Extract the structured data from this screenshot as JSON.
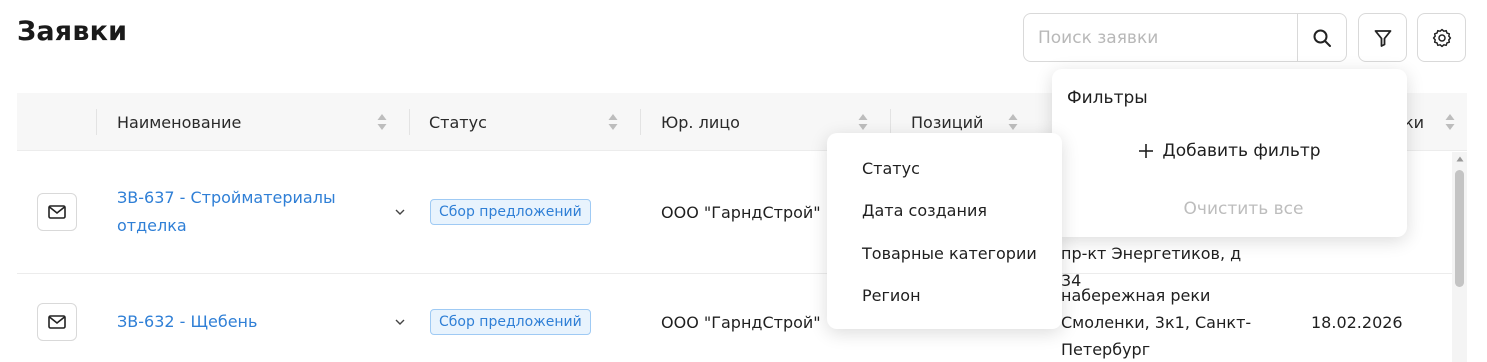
{
  "page": {
    "title": "Заявки"
  },
  "search": {
    "placeholder": "Поиск заявки"
  },
  "icons": {
    "search": "search-icon",
    "filter": "funnel-icon",
    "settings": "gear-icon",
    "mail": "mail-icon",
    "sort": "sort-icon",
    "chevron": "chevron-down-icon",
    "plus": "plus-icon"
  },
  "table": {
    "columns": {
      "name": "Наименование",
      "status": "Статус",
      "org": "Юр. лицо",
      "positions": "Позиций",
      "last_partial": "ки"
    },
    "rows": [
      {
        "name_line1": "ЗВ-637 - Стройматериалы",
        "name_line2": "отделка",
        "status": "Сбор предложений",
        "org": "ООО \"ГарндСтрой\"",
        "address": "пр-кт Энергетиков, д 34"
      },
      {
        "name_line1": "ЗВ-632 - Щебень",
        "status": "Сбор предложений",
        "org": "ООО \"ГарндСтрой\"",
        "address_line1": "набережная реки",
        "address_line2": "Смоленки, 3к1, Санкт-",
        "address_line3": "Петербург",
        "date": "18.02.2026"
      }
    ]
  },
  "filters_panel": {
    "title": "Фильтры",
    "add_filter": "Добавить фильтр",
    "clear_all": "Очистить все"
  },
  "filter_dropdown": {
    "items": [
      "Статус",
      "Дата создания",
      "Товарные категории",
      "Регион"
    ]
  },
  "colors": {
    "link": "#2f7fd6",
    "badge_bg": "#e8f3fd",
    "badge_border": "#9fcaf4",
    "header_bg": "#f7f7f7",
    "muted": "#bdbdbd"
  }
}
